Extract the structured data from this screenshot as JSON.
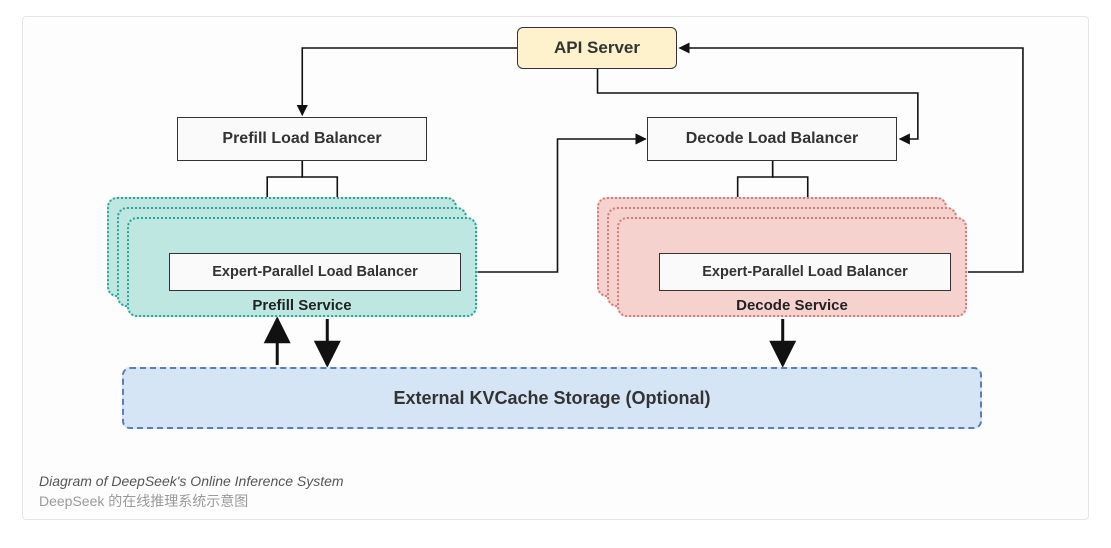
{
  "api_server": {
    "label": "API Server"
  },
  "prefill": {
    "load_balancer_label": "Prefill Load Balancer",
    "ep_label": "Expert-Parallel Load Balancer",
    "service_label": "Prefill Service"
  },
  "decode": {
    "load_balancer_label": "Decode Load Balancer",
    "ep_label": "Expert-Parallel Load Balancer",
    "service_label": "Decode Service"
  },
  "kvcache": {
    "label": "External KVCache Storage (Optional)"
  },
  "captions": {
    "en": "Diagram of DeepSeek's Online Inference System",
    "zh": "DeepSeek 的在线推理系统示意图"
  },
  "colors": {
    "api_bg": "#fdf2cc",
    "prefill_bg": "#bfe7e1",
    "prefill_border": "#2aa59b",
    "decode_bg": "#f6d2cf",
    "decode_border": "#d97a7a",
    "kvcache_bg": "#d6e5f6",
    "kvcache_border": "#5b7fb2"
  }
}
